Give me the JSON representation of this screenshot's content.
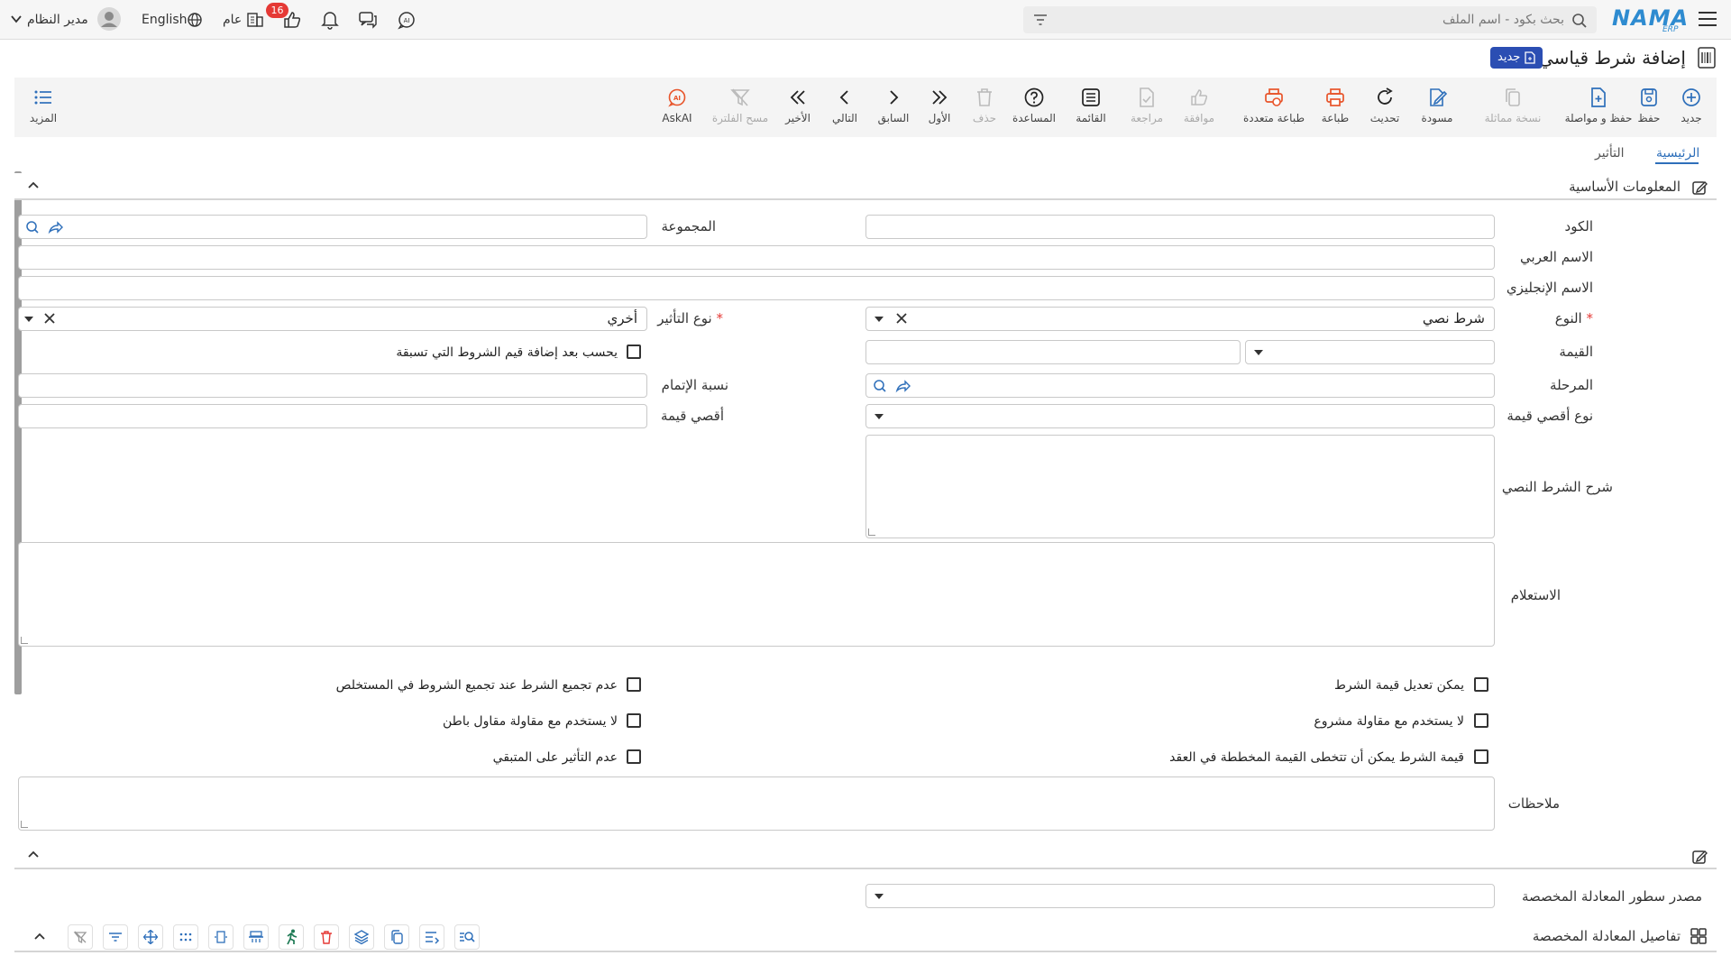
{
  "topbar": {
    "brand": "NAMA",
    "brand_sub": "ERP",
    "search_placeholder": "بحث بكود - اسم الملف",
    "language": "English",
    "user": "مدير النظام",
    "general": "عام",
    "notification_count": "16"
  },
  "page": {
    "title": "إضافة شرط قياسي",
    "status_badge": "جديد"
  },
  "toolbar": {
    "new": "جديد",
    "save": "حفظ",
    "save_continue": "حفظ و مواصلة",
    "duplicate": "نسخة مماثلة",
    "draft": "مسودة",
    "refresh": "تحديث",
    "print": "طباعة",
    "multi_print": "طباعة متعددة",
    "approve": "موافقة",
    "review": "مراجعة",
    "list": "القائمة",
    "help": "المساعدة",
    "delete": "حذف",
    "first": "الأول",
    "previous": "السابق",
    "next": "التالي",
    "last": "الأخير",
    "clear_filter": "مسح الفلترة",
    "ask_ai": "AskAI",
    "more": "المزيد"
  },
  "tabs": {
    "main": "الرئيسية",
    "effect": "التأثير"
  },
  "sections": {
    "basic_info": "المعلومات الأساسية",
    "formula_details": "تفاصيل المعادلة المخصصة"
  },
  "fields": {
    "code_label": "الكود",
    "group_label": "المجموعة",
    "arabic_name_label": "الاسم العربي",
    "english_name_label": "الاسم الإنجليزي",
    "type_label": "النوع",
    "type_value": "شرط نصي",
    "effect_type_label": "نوع التأثير",
    "effect_type_value": "أخري",
    "value_label": "القيمة",
    "calc_after_label": "يحسب بعد إضافة قيم الشروط التي تسبقة",
    "stage_label": "المرحلة",
    "completion_label": "نسبة الإتمام",
    "max_value_type_label": "نوع أقصي قيمة",
    "max_value_label": "أقصي قيمة",
    "text_desc_label": "شرح الشرط النصي",
    "query_label": "الاستعلام",
    "notes_label": "ملاحظات",
    "formula_source_label": "مصدر سطور المعادلة المخصصة"
  },
  "checkboxes": {
    "editable_value": "يمكن تعديل قيمة الشرط",
    "no_project_contract": "لا يستخدم مع مقاولة مشروع",
    "exceed_planned": "قيمة الشرط يمكن أن تتخطى القيمة المخططة في العقد",
    "no_aggregate": "عدم تجميع الشرط عند تجميع الشروط في المستخلص",
    "no_subcontract": "لا يستخدم مع مقاولة مقاول باطن",
    "no_effect_remaining": "عدم التأثير على المتبقي"
  },
  "colors": {
    "accent": "#2e6fba",
    "badge": "#2b4eb3",
    "icon_blue": "#2e6fba",
    "icon_orange": "#e8542a",
    "notification": "#e53935"
  }
}
